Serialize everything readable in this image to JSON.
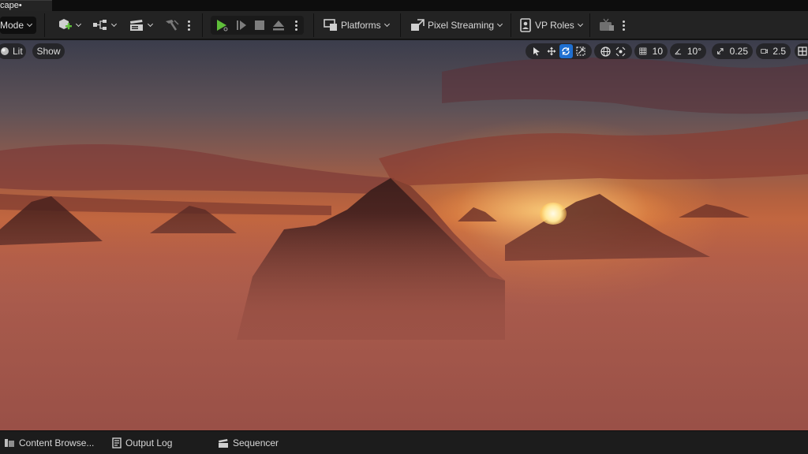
{
  "window": {
    "doc_tab": "cape•"
  },
  "toolbar": {
    "mode_label": "Mode",
    "platforms_label": "Platforms",
    "pixel_streaming_label": "Pixel Streaming",
    "vp_roles_label": "VP Roles"
  },
  "viewport": {
    "lit_label": "Lit",
    "show_label": "Show",
    "grid_snap_value": "10",
    "rotation_snap_value": "10°",
    "scale_snap_value": "0.25",
    "camera_speed_value": "2.5"
  },
  "bottom_tabs": {
    "content_browser": "Content Browse...",
    "output_log": "Output Log",
    "sequencer": "Sequencer"
  },
  "colors": {
    "accent": "#1f6fd0",
    "play_green": "#5fbf3a",
    "toolbar_bg": "#232323"
  },
  "icons": [
    "add-actor-icon",
    "blueprint-icon",
    "cinematics-icon",
    "build-icon",
    "play-icon",
    "step-icon",
    "stop-icon",
    "eject-icon",
    "platforms-icon",
    "pixel-streaming-icon",
    "vp-roles-icon",
    "tv-icon",
    "select-icon",
    "translate-icon",
    "rotate-icon",
    "scale-icon",
    "world-icon",
    "surface-snap-icon",
    "grid-icon",
    "angle-icon",
    "scale-snap-icon",
    "camera-icon",
    "layout-icon"
  ]
}
